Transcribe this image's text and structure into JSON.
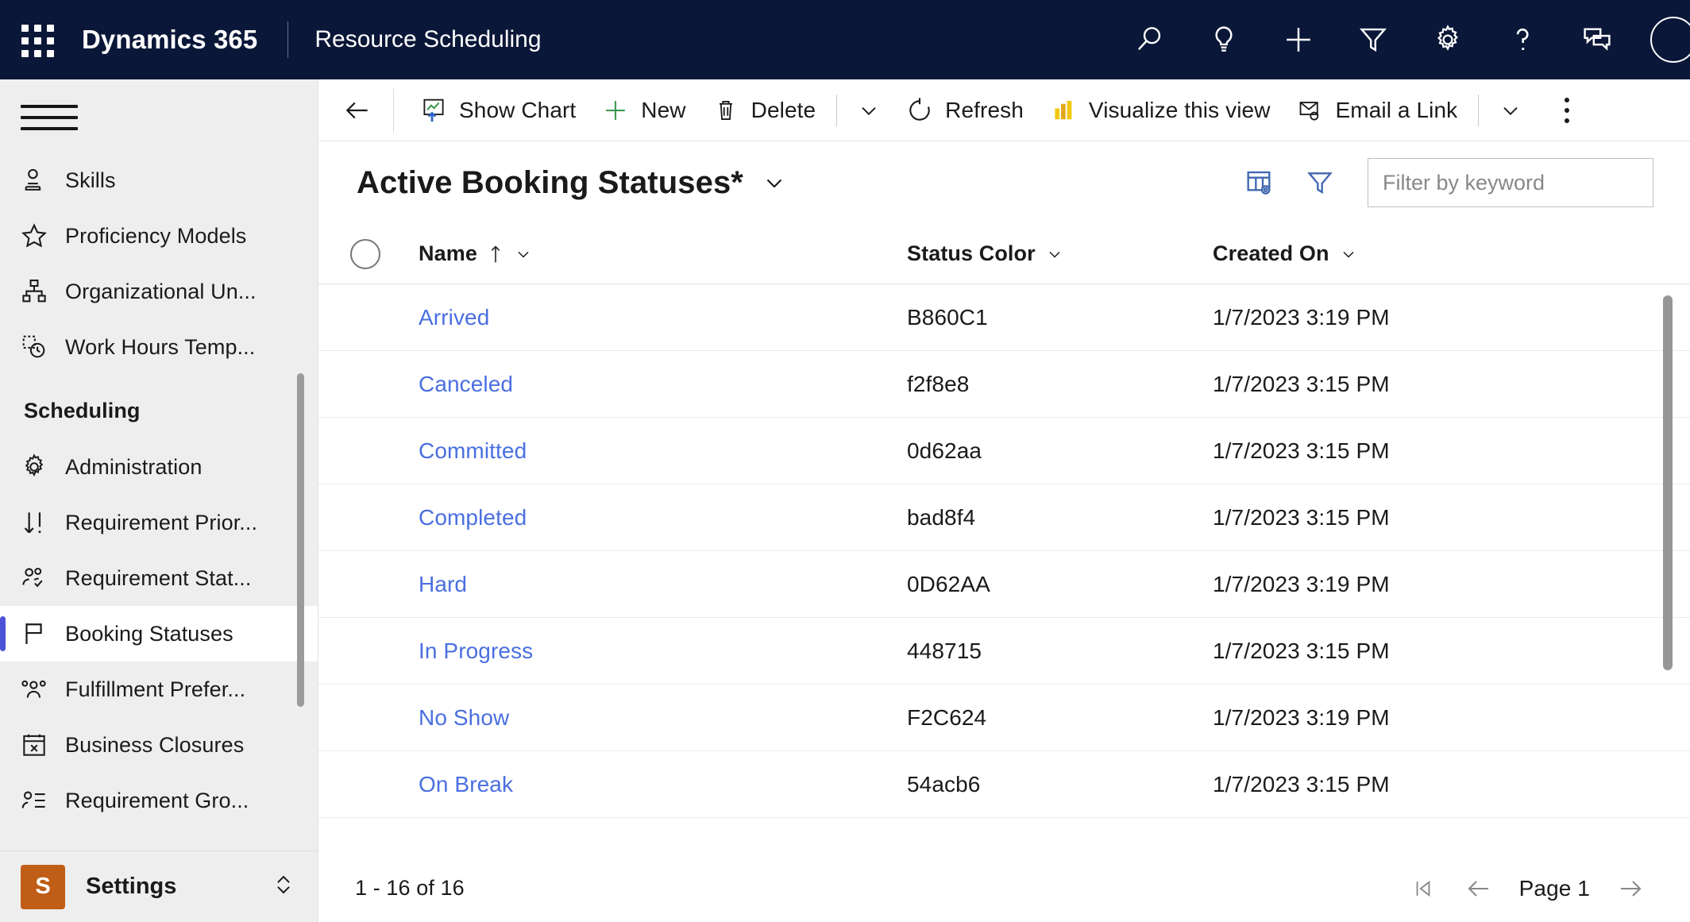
{
  "topbar": {
    "waffle_label": "app-launcher",
    "brand": "Dynamics 365",
    "app_name": "Resource Scheduling",
    "icons": [
      {
        "name": "search-icon",
        "label": "Search"
      },
      {
        "name": "lightbulb-icon",
        "label": "Tips"
      },
      {
        "name": "plus-icon",
        "label": "Quick create"
      },
      {
        "name": "filter-funnel-icon",
        "label": "Filter"
      },
      {
        "name": "gear-icon",
        "label": "Settings"
      },
      {
        "name": "question-mark-icon",
        "label": "Help"
      },
      {
        "name": "feedback-chat-icon",
        "label": "Feedback"
      },
      {
        "name": "avatar",
        "label": "Account"
      }
    ]
  },
  "sidebar": {
    "hamburger_label": "Site map",
    "items": [
      {
        "label": "Skills",
        "icon": "skill-person-icon",
        "selected": false
      },
      {
        "label": "Proficiency Models",
        "icon": "star-icon",
        "selected": false
      },
      {
        "label": "Organizational Un...",
        "icon": "org-hierarchy-icon",
        "selected": false
      },
      {
        "label": "Work Hours Temp...",
        "icon": "work-hours-clock-icon",
        "selected": false
      }
    ],
    "group_label": "Scheduling",
    "group_items": [
      {
        "label": "Administration",
        "icon": "gear-icon",
        "selected": false
      },
      {
        "label": "Requirement Prior...",
        "icon": "sort-priority-icon",
        "selected": false
      },
      {
        "label": "Requirement Stat...",
        "icon": "people-check-icon",
        "selected": false
      },
      {
        "label": "Booking Statuses",
        "icon": "flag-icon",
        "selected": true
      },
      {
        "label": "Fulfillment Prefer...",
        "icon": "people-group-icon",
        "selected": false
      },
      {
        "label": "Business Closures",
        "icon": "calendar-x-icon",
        "selected": false
      },
      {
        "label": "Requirement Gro...",
        "icon": "person-list-icon",
        "selected": false
      }
    ],
    "settings": {
      "badge": "S",
      "label": "Settings",
      "chevron_icon": "expand-collapse-chevron-icon"
    }
  },
  "commandbar": {
    "back_icon": "back-arrow-icon",
    "buttons": [
      {
        "label": "Show Chart",
        "icon": "show-chart-icon"
      },
      {
        "label": "New",
        "icon": "plus-icon"
      },
      {
        "label": "Delete",
        "icon": "trash-icon"
      }
    ],
    "delete_chevron_icon": "chevron-down-icon",
    "refresh": {
      "label": "Refresh",
      "icon": "refresh-icon"
    },
    "visualize": {
      "label": "Visualize this view",
      "icon": "power-bi-icon"
    },
    "email_link": {
      "label": "Email a Link",
      "icon": "email-link-icon"
    },
    "email_chevron_icon": "chevron-down-icon",
    "overflow_icon": "more-commands-icon"
  },
  "view": {
    "title": "Active Booking Statuses*",
    "title_chevron_icon": "chevron-down-icon",
    "edit_columns_icon": "edit-columns-icon",
    "edit_filters_icon": "edit-filters-icon",
    "search_placeholder": "Filter by keyword",
    "search_value": ""
  },
  "grid": {
    "select_all_icon": "select-all-circle-icon",
    "columns": [
      {
        "label": "Name",
        "sorted": true,
        "sort_icon": "sort-ascending-arrow-icon",
        "chevron_icon": "chevron-down-icon"
      },
      {
        "label": "Status Color",
        "sorted": false,
        "chevron_icon": "chevron-down-icon"
      },
      {
        "label": "Created On",
        "sorted": false,
        "chevron_icon": "chevron-down-icon"
      }
    ],
    "rows": [
      {
        "name": "Arrived",
        "status_color": "B860C1",
        "created_on": "1/7/2023 3:19 PM"
      },
      {
        "name": "Canceled",
        "status_color": "f2f8e8",
        "created_on": "1/7/2023 3:15 PM"
      },
      {
        "name": "Committed",
        "status_color": "0d62aa",
        "created_on": "1/7/2023 3:15 PM"
      },
      {
        "name": "Completed",
        "status_color": "bad8f4",
        "created_on": "1/7/2023 3:15 PM"
      },
      {
        "name": "Hard",
        "status_color": "0D62AA",
        "created_on": "1/7/2023 3:19 PM"
      },
      {
        "name": "In Progress",
        "status_color": "448715",
        "created_on": "1/7/2023 3:15 PM"
      },
      {
        "name": "No Show",
        "status_color": "F2C624",
        "created_on": "1/7/2023 3:19 PM"
      },
      {
        "name": "On Break",
        "status_color": "54acb6",
        "created_on": "1/7/2023 3:15 PM"
      }
    ]
  },
  "footer": {
    "record_count": "1 - 16 of 16",
    "first_page_icon": "first-page-icon",
    "prev_page_icon": "previous-page-icon",
    "page_label": "Page 1",
    "next_page_icon": "next-page-icon"
  },
  "colors": {
    "nav_bg": "#0b1738",
    "accent_link": "#4a6fe0",
    "selected_indicator": "#4b53d4",
    "settings_badge": "#c05d16",
    "sidebar_bg": "#eeeeee"
  }
}
